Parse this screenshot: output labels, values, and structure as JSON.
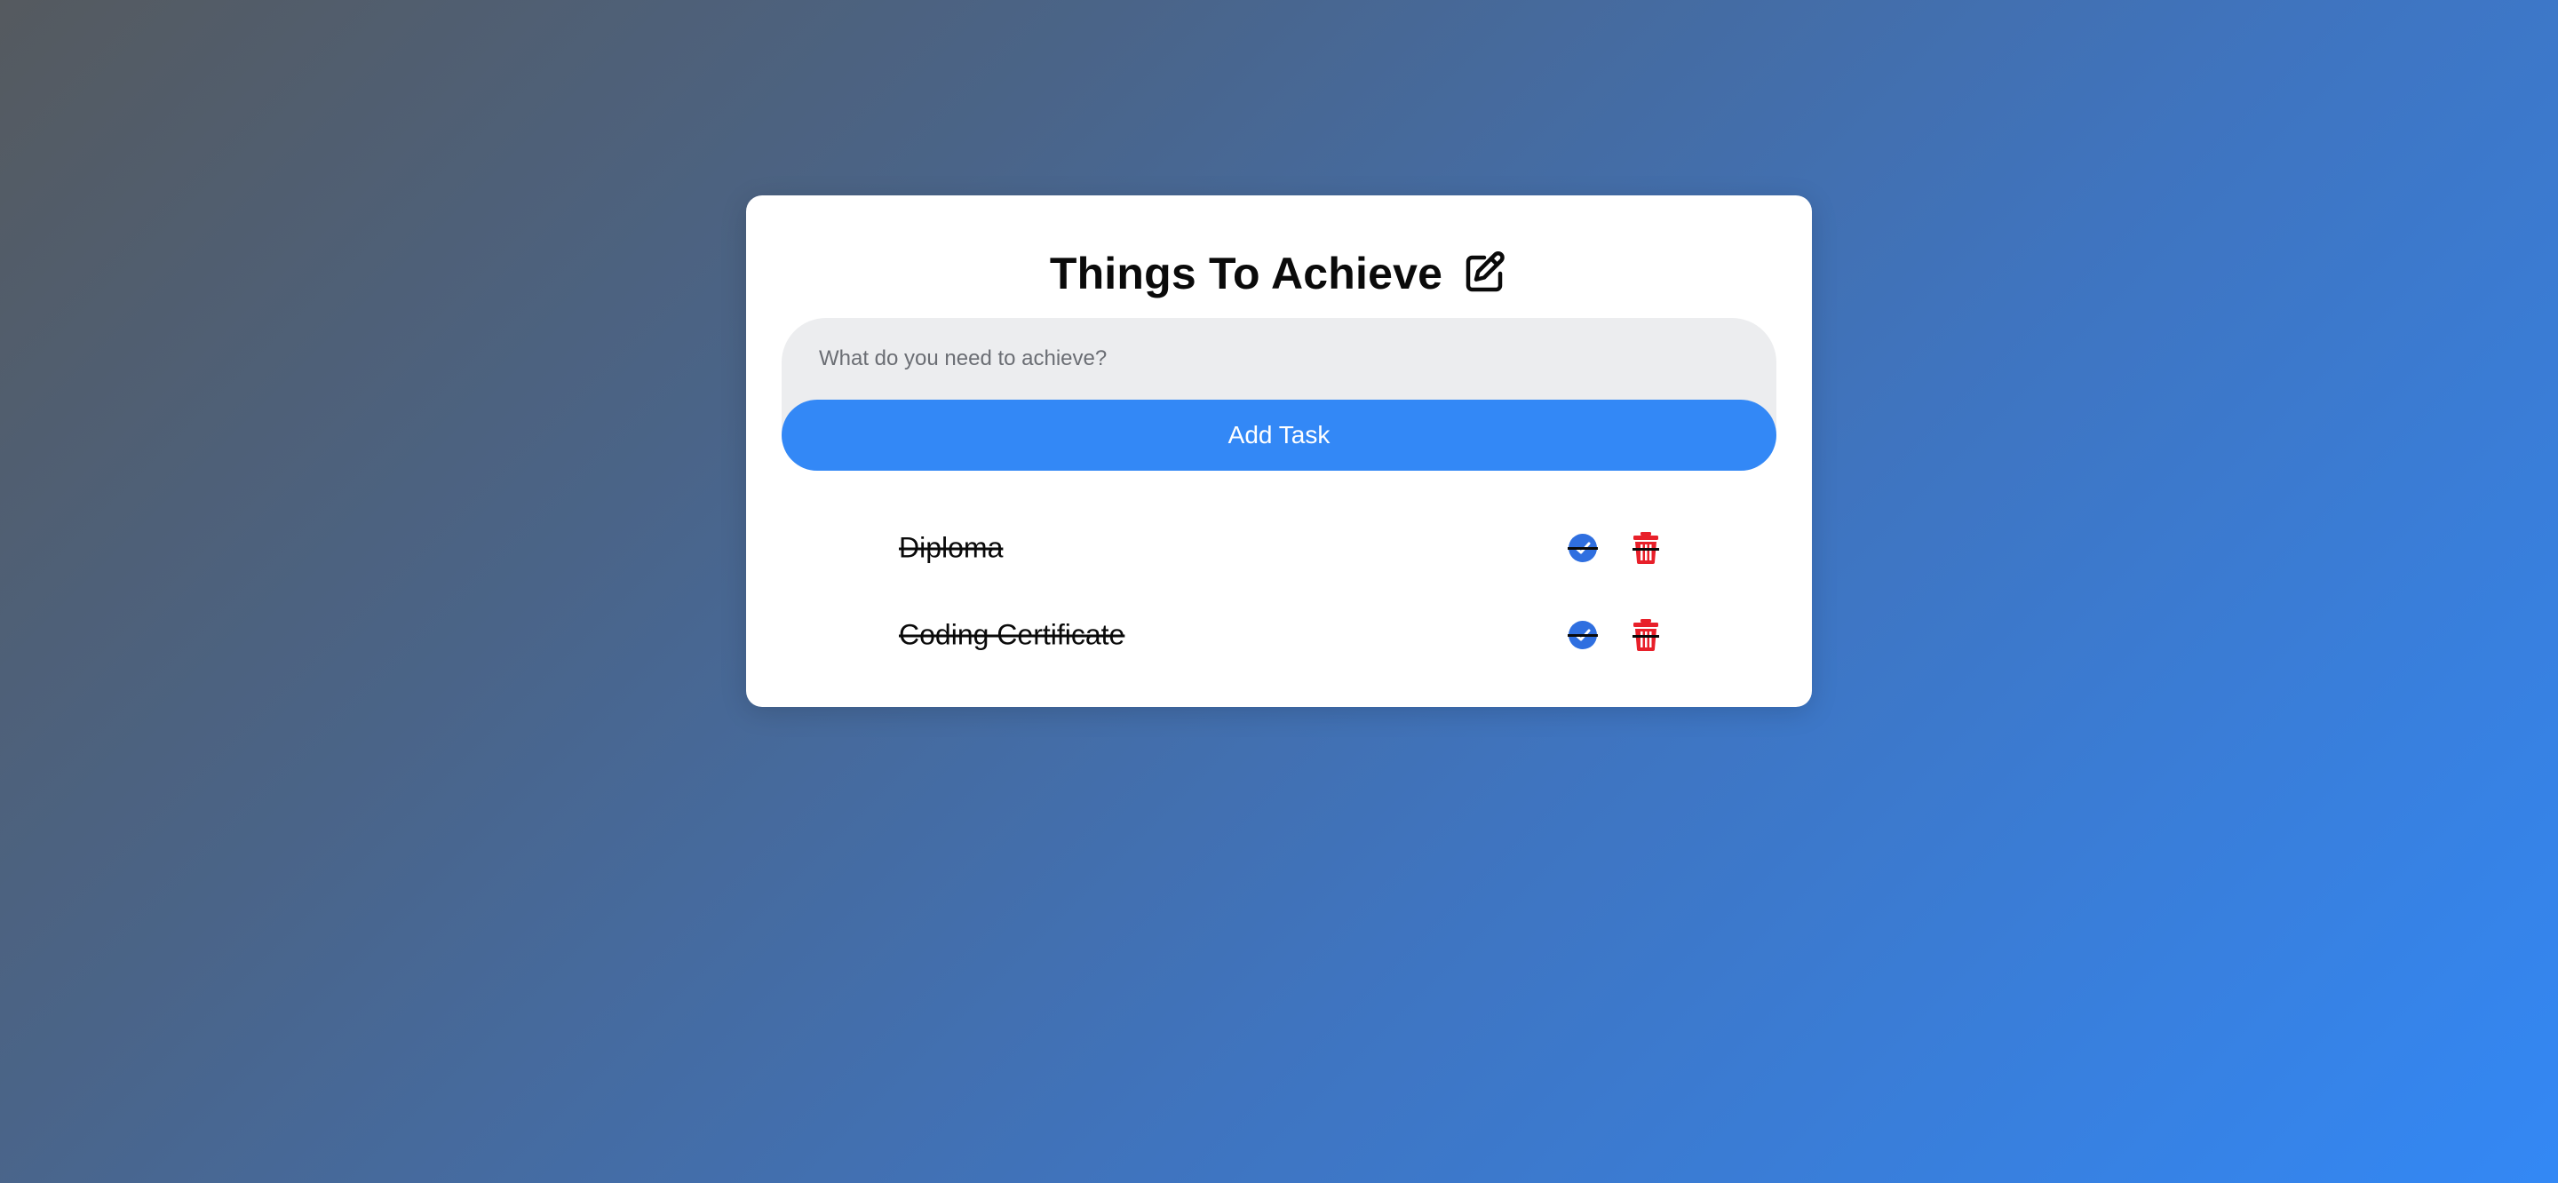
{
  "header": {
    "title": "Things To Achieve",
    "title_icon": "edit-icon"
  },
  "form": {
    "input_placeholder": "What do you need to achieve?",
    "input_value": "",
    "add_button_label": "Add Task"
  },
  "tasks": [
    {
      "text": "Diploma",
      "completed": true
    },
    {
      "text": "Coding Certificate",
      "completed": true
    }
  ],
  "icons": {
    "complete": "check-circle-icon",
    "delete": "trash-icon"
  },
  "colors": {
    "accent": "#3388f6",
    "complete_icon": "#2f6fe0",
    "delete_icon": "#e8202a",
    "input_background": "#ecedef"
  }
}
